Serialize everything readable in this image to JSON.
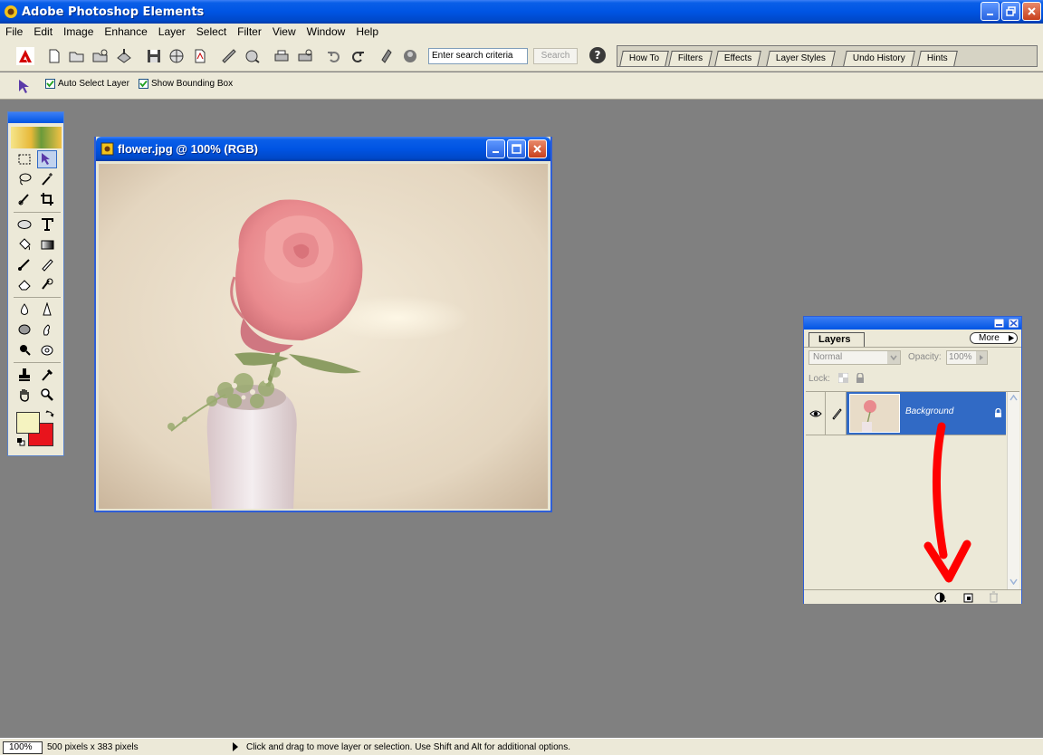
{
  "app": {
    "title": "Adobe Photoshop Elements"
  },
  "menu": [
    "File",
    "Edit",
    "Image",
    "Enhance",
    "Layer",
    "Select",
    "Filter",
    "View",
    "Window",
    "Help"
  ],
  "shortcuts": {
    "search_placeholder": "Enter search criteria",
    "search_button": "Search",
    "help_glyph": "?"
  },
  "palette_well": {
    "tabs": [
      "How To",
      "Filters",
      "Effects",
      "Layer Styles",
      "Undo History",
      "Hints"
    ]
  },
  "options": {
    "auto_select": "Auto Select Layer",
    "bounding_box": "Show Bounding Box"
  },
  "colors": {
    "foreground": "#f5f3c0",
    "background": "#e8141c",
    "accent": "#316ac5"
  },
  "document": {
    "title": "flower.jpg @ 100% (RGB)"
  },
  "layers_palette": {
    "tab": "Layers",
    "more": "More",
    "blend_mode": "Normal",
    "opacity_label": "Opacity:",
    "opacity_value": "100%",
    "lock_label": "Lock:",
    "layer_name": "Background"
  },
  "status": {
    "zoom": "100%",
    "dimensions": "500 pixels x 383 pixels",
    "hint": "Click and drag to move layer or selection.  Use Shift and Alt for additional options."
  }
}
